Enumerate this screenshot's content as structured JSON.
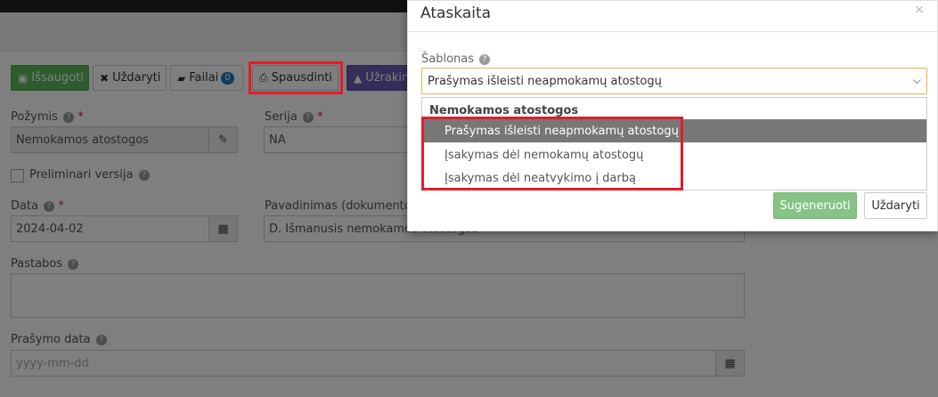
{
  "toolbar": {
    "save_label": "Išsaugoti",
    "close_label": "Uždaryti",
    "files_label": "Failai",
    "files_count": "0",
    "print_label": "Spausdinti",
    "lock_label": "Užrakint"
  },
  "form": {
    "pozymis_label": "Požymis",
    "pozymis_value": "Nemokamos atostogos",
    "serija_label": "Serija",
    "serija_value": "NA",
    "preliminari_label": "Preliminari versija",
    "data_label": "Data",
    "data_value": "2024-04-02",
    "pavadinimas_label": "Pavadinimas (dokumento a",
    "pavadinimas_value": "D. Išmanusis nemokamos atostogos",
    "pastabos_label": "Pastabos",
    "prasymo_data_label": "Prašymo data",
    "prasymo_data_placeholder": "yyyy-mm-dd",
    "required_mark": "*",
    "help_glyph": "?"
  },
  "modal": {
    "title": "Ataskaita",
    "close_glyph": "×",
    "template_label": "Šablonas",
    "template_selected": "Prašymas išleisti neapmokamų atostogų",
    "dropdown": {
      "group_label": "Nemokamos atostogos",
      "options": [
        "Prašymas išleisti neapmokamų atostogų",
        "Įsakymas dėl nemokamų atostogų",
        "Įsakymas dėl neatvykimo į darbą"
      ],
      "selected_index": 0
    },
    "generate_label": "Sugeneruoti",
    "close_label": "Uždaryti"
  },
  "icons": {
    "save": "floppy-disk-icon",
    "close": "x-icon",
    "files": "folder-open-icon",
    "print": "printer-icon",
    "lock": "lock-icon",
    "pencil": "pencil-icon",
    "calendar": "calendar-icon",
    "chevron": "chevron-down-icon"
  },
  "colors": {
    "save_button": "#5cb85c",
    "lock_button": "#6f5bb5",
    "highlight": "#e11d2a",
    "selected_option": "#777777",
    "generate_button": "#86c386"
  }
}
